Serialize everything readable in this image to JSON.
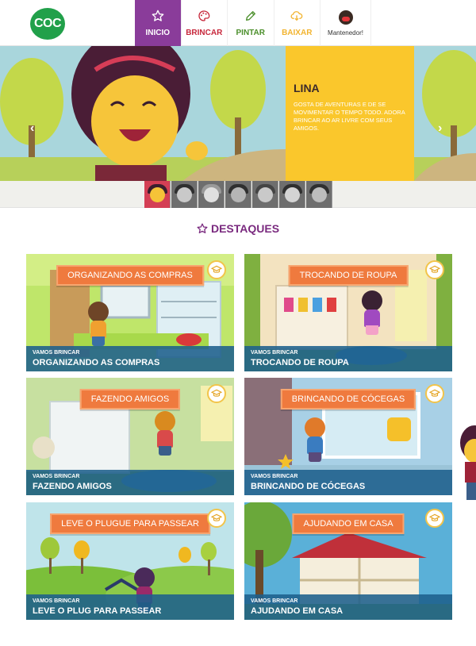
{
  "header": {
    "logo_text": "COC",
    "nav": [
      {
        "label": "INICIO",
        "icon": "star-outline-icon",
        "color": "#ffffff",
        "active": true
      },
      {
        "label": "BRINCAR",
        "icon": "palette-icon",
        "color": "#c7283c"
      },
      {
        "label": "PINTAR",
        "icon": "pencil-icon",
        "color": "#4b8f2b"
      },
      {
        "label": "BAIXAR",
        "icon": "cloud-download-icon",
        "color": "#f2b430"
      },
      {
        "label": "Mantenedor!",
        "icon": "avatar-icon",
        "color": "#333333"
      }
    ]
  },
  "hero": {
    "name": "LINA",
    "description": "GOSTA DE AVENTURAS E DE SE MOVIMENTAR O TEMPO TODO. ADORA BRINCAR AO AR LIVRE COM SEUS AMIGOS.",
    "prev_icon": "chevron-left-icon",
    "next_icon": "chevron-right-icon",
    "thumbnails": 7,
    "active_thumbnail": 1
  },
  "destaques": {
    "title": "DESTAQUES",
    "cards": [
      {
        "banner": "ORGANIZANDO AS COMPRAS",
        "kicker": "VAMOS BRINCAR",
        "title": "ORGANIZANDO AS COMPRAS"
      },
      {
        "banner": "TROCANDO DE ROUPA",
        "kicker": "VAMOS BRINCAR",
        "title": "TROCANDO DE ROUPA"
      },
      {
        "banner": "FAZENDO AMIGOS",
        "kicker": "VAMOS BRINCAR",
        "title": "FAZENDO AMIGOS"
      },
      {
        "banner": "BRINCANDO DE CÓCEGAS",
        "kicker": "VAMOS BRINCAR",
        "title": "BRINCANDO DE CÓCEGAS"
      },
      {
        "banner": "LEVE O PLUGUE PARA PASSEAR",
        "kicker": "VAMOS BRINCAR",
        "title": "LEVE O PLUG PARA PASSEAR"
      },
      {
        "banner": "AJUDANDO EM CASA",
        "kicker": "VAMOS BRINCAR",
        "title": "AJUDANDO EM CASA"
      }
    ]
  },
  "colors": {
    "purple": "#8a3c9a",
    "title_purple": "#7a2a7f",
    "hero_yellow": "#fac72c",
    "banner_orange": "#ef7a3e",
    "card_info_blue": "#1e608c",
    "logo_green": "#21a04a"
  }
}
